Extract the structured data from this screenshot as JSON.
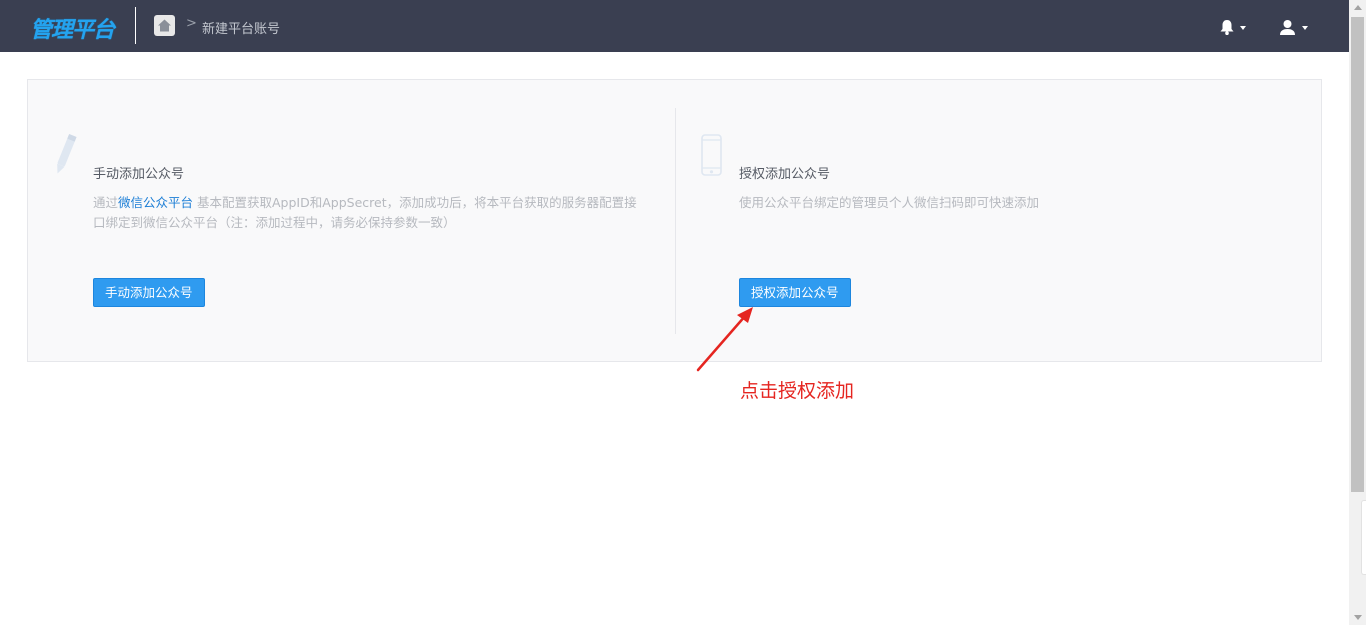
{
  "header": {
    "logo_text": "管理平台",
    "breadcrumb": {
      "home_icon": "home-icon",
      "current": "新建平台账号"
    },
    "actions": {
      "notifications_icon": "bell-icon",
      "user_icon": "user-icon"
    }
  },
  "manual": {
    "icon": "pen-icon",
    "title": "手动添加公众号",
    "desc_prefix": "通过",
    "desc_link": "微信公众平台",
    "desc_line1_rest": " 基本配置获取AppID和AppSecret，添加成功后，将本平台获取的服务器配置接",
    "desc_line2": "口绑定到微信公众平台（注：添加过程中，请务必保持参数一致）",
    "button_label": "手动添加公众号"
  },
  "auth": {
    "icon": "phone-icon",
    "title": "授权添加公众号",
    "desc": "使用公众平台绑定的管理员个人微信扫码即可快速添加",
    "button_label": "授权添加公众号"
  },
  "annotation": {
    "text": "点击授权添加",
    "color": "#e52520"
  },
  "colors": {
    "topbar": "#3a3f51",
    "logo": "#24a3ef",
    "primary_button": "#2f9bf0",
    "link": "#1c7ed6"
  }
}
